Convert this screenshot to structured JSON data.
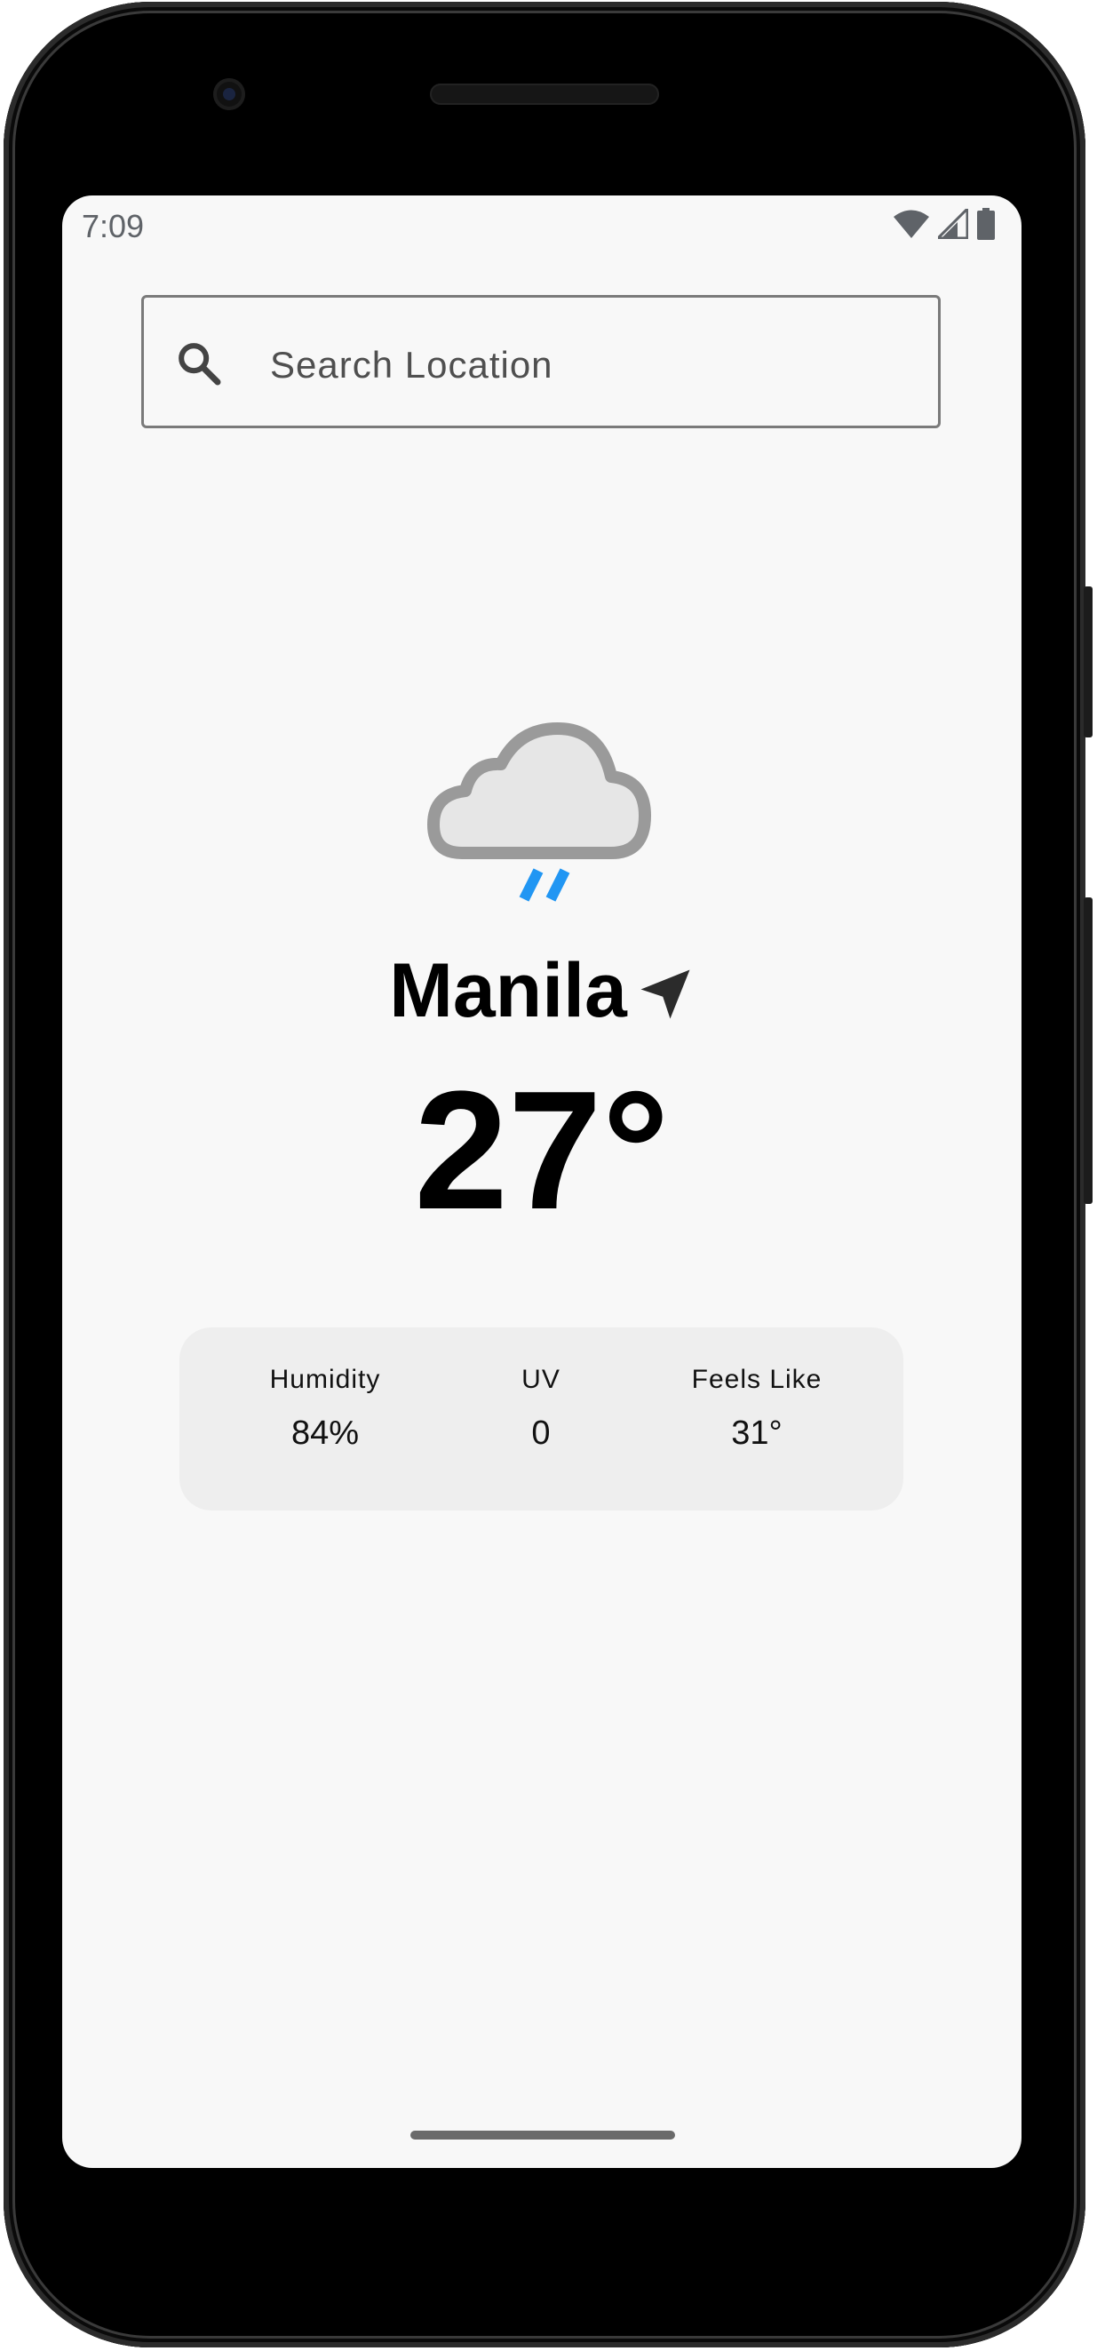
{
  "status_bar": {
    "time": "7:09",
    "icons": [
      "wifi-icon",
      "cell-signal-icon",
      "battery-icon"
    ]
  },
  "search": {
    "placeholder": "Search Location",
    "icon": "search-icon"
  },
  "weather": {
    "condition_icon": "rain-cloud-icon",
    "city": "Manila",
    "location_icon": "navigation-arrow-icon",
    "temperature": "27°"
  },
  "stats": {
    "humidity": {
      "label": "Humidity",
      "value": "84%"
    },
    "uv": {
      "label": "UV",
      "value": "0"
    },
    "feels_like": {
      "label": "Feels Like",
      "value": "31°"
    }
  },
  "colors": {
    "screen_background": "#f8f8f8",
    "card_background": "#eeeeee",
    "rain_accent": "#2196f3"
  }
}
